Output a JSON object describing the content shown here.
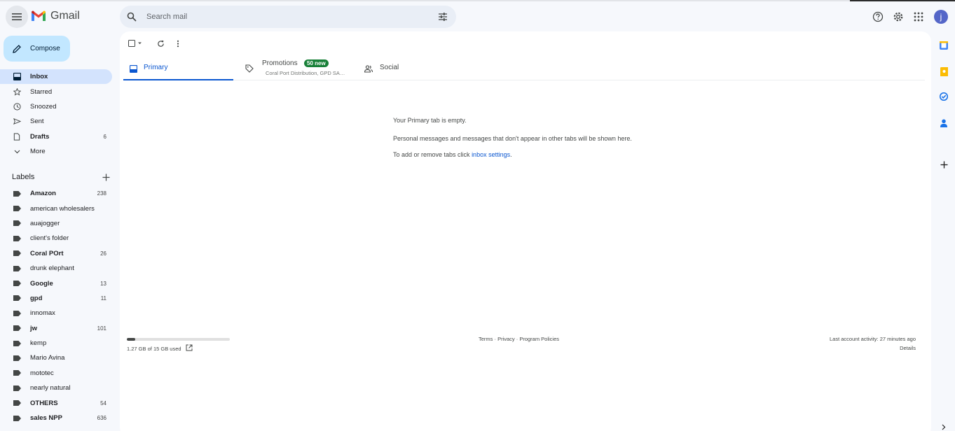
{
  "header": {
    "app_name": "Gmail",
    "search_placeholder": "Search mail",
    "avatar_letter": "j",
    "icons": [
      "main-menu-icon",
      "search-icon",
      "search-options-icon",
      "help-icon",
      "settings-icon",
      "apps-grid-icon"
    ]
  },
  "sidebar": {
    "compose_label": "Compose",
    "nav": [
      {
        "label": "Inbox",
        "icon": "inbox-icon",
        "count": "",
        "active": true,
        "bold": true
      },
      {
        "label": "Starred",
        "icon": "star-icon",
        "count": "",
        "active": false,
        "bold": false
      },
      {
        "label": "Snoozed",
        "icon": "clock-icon",
        "count": "",
        "active": false,
        "bold": false
      },
      {
        "label": "Sent",
        "icon": "send-icon",
        "count": "",
        "active": false,
        "bold": false
      },
      {
        "label": "Drafts",
        "icon": "draft-icon",
        "count": "6",
        "active": false,
        "bold": true
      },
      {
        "label": "More",
        "icon": "chevron-down-icon",
        "count": "",
        "active": false,
        "bold": false
      }
    ],
    "labels_title": "Labels",
    "labels": [
      {
        "label": "Amazon",
        "count": "238",
        "bold": true
      },
      {
        "label": "american wholesalers",
        "count": "",
        "bold": false
      },
      {
        "label": "auajogger",
        "count": "",
        "bold": false
      },
      {
        "label": "client's folder",
        "count": "",
        "bold": false
      },
      {
        "label": "Coral POrt",
        "count": "26",
        "bold": true
      },
      {
        "label": "drunk elephant",
        "count": "",
        "bold": false
      },
      {
        "label": "Google",
        "count": "13",
        "bold": true
      },
      {
        "label": "gpd",
        "count": "11",
        "bold": true
      },
      {
        "label": "innomax",
        "count": "",
        "bold": false
      },
      {
        "label": "jw",
        "count": "101",
        "bold": true
      },
      {
        "label": "kemp",
        "count": "",
        "bold": false
      },
      {
        "label": "Mario Avina",
        "count": "",
        "bold": false
      },
      {
        "label": "mototec",
        "count": "",
        "bold": false
      },
      {
        "label": "nearly natural",
        "count": "",
        "bold": false
      },
      {
        "label": "OTHERS",
        "count": "54",
        "bold": true
      },
      {
        "label": "sales NPP",
        "count": "636",
        "bold": true
      }
    ]
  },
  "tabs": {
    "primary": "Primary",
    "promotions": "Promotions",
    "promotions_badge": "50 new",
    "promotions_senders": "Coral Port Distribution, GPD SA…",
    "social": "Social"
  },
  "empty_state": {
    "title": "Your Primary tab is empty.",
    "line1": "Personal messages and messages that don't appear in other tabs will be shown here.",
    "line2_prefix": "To add or remove tabs click ",
    "line2_link": "inbox settings",
    "line2_suffix": "."
  },
  "footer": {
    "storage_text": "1.27 GB of 15 GB used",
    "storage_fraction": 0.085,
    "links": "Terms · Privacy · Program Policies",
    "last_activity": "Last account activity: 27 minutes ago",
    "details": "Details"
  },
  "right_rail": [
    "calendar-icon",
    "keep-icon",
    "tasks-icon",
    "contacts-icon",
    "add-addon-icon",
    "expand-panel-icon"
  ],
  "colors": {
    "compose_bg": "#c2e7ff",
    "active_nav_bg": "#d3e3fd",
    "primary_tab": "#0b57d0",
    "badge_bg": "#188038",
    "avatar_bg": "#5466c8"
  }
}
